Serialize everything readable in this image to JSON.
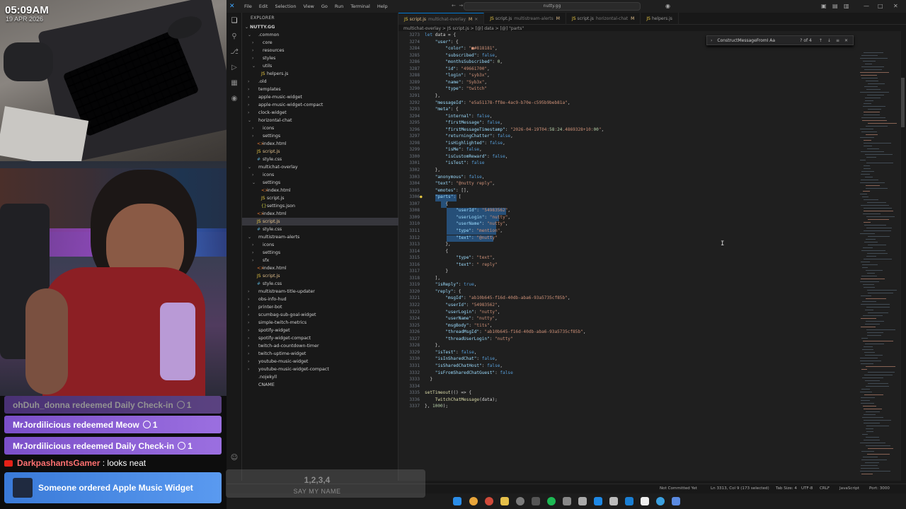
{
  "overlay": {
    "time": "05:09AM",
    "date": "19 APR 2026",
    "alerts": [
      {
        "user": "ohDuh_donna",
        "text": "redeemed Daily Check-in",
        "cost": "1"
      },
      {
        "user": "MrJordilicious",
        "text": "redeemed Meow",
        "cost": "1"
      },
      {
        "user": "MrJordilicious",
        "text": "redeemed Daily Check-in",
        "cost": "1"
      }
    ],
    "chat": {
      "user": "DarkpashantsGamer",
      "message": ": looks neat"
    },
    "order": "Someone ordered Apple Music Widget",
    "ghost": {
      "numbers": "1,2,3,4",
      "text": "SAY MY NAME"
    }
  },
  "titlebar": {
    "menus": [
      "File",
      "Edit",
      "Selection",
      "View",
      "Go",
      "Run",
      "Terminal",
      "Help"
    ],
    "search": "nutty.gg"
  },
  "explorer": {
    "title": "EXPLORER",
    "root": "NUTTY.GG",
    "items": [
      {
        "label": ".common",
        "type": "folder",
        "open": true
      },
      {
        "label": "core",
        "type": "folder"
      },
      {
        "label": "resources",
        "type": "folder"
      },
      {
        "label": "styles",
        "type": "folder"
      },
      {
        "label": "utils",
        "type": "folder",
        "open": true
      },
      {
        "label": "helpers.js",
        "type": "js"
      },
      {
        "label": ".old",
        "type": "folder"
      },
      {
        "label": "templates",
        "type": "folder"
      },
      {
        "label": "apple-music-widget",
        "type": "folder"
      },
      {
        "label": "apple-music-widget-compact",
        "type": "folder"
      },
      {
        "label": "clock-widget",
        "type": "folder"
      },
      {
        "label": "horizontal-chat",
        "type": "folder",
        "open": true
      },
      {
        "label": "icons",
        "type": "folder"
      },
      {
        "label": "settings",
        "type": "folder"
      },
      {
        "label": "index.html",
        "type": "html"
      },
      {
        "label": "script.js",
        "type": "js",
        "mod": "M"
      },
      {
        "label": "style.css",
        "type": "css"
      },
      {
        "label": "multichat-overlay",
        "type": "folder",
        "open": true
      },
      {
        "label": "icons",
        "type": "folder"
      },
      {
        "label": "settings",
        "type": "folder",
        "open": true
      },
      {
        "label": "index.html",
        "type": "html"
      },
      {
        "label": "script.js",
        "type": "js"
      },
      {
        "label": "settings.json",
        "type": "json"
      },
      {
        "label": "index.html",
        "type": "html"
      },
      {
        "label": "script.js",
        "type": "js",
        "mod": "M"
      },
      {
        "label": "style.css",
        "type": "css"
      },
      {
        "label": "multistream-alerts",
        "type": "folder",
        "open": true
      },
      {
        "label": "icons",
        "type": "folder"
      },
      {
        "label": "settings",
        "type": "folder"
      },
      {
        "label": "sfx",
        "type": "folder"
      },
      {
        "label": "index.html",
        "type": "html"
      },
      {
        "label": "script.js",
        "type": "js",
        "mod": "M"
      },
      {
        "label": "style.css",
        "type": "css"
      },
      {
        "label": "multistream-title-updater",
        "type": "folder"
      },
      {
        "label": "obs-info-hud",
        "type": "folder"
      },
      {
        "label": "printer-bot",
        "type": "folder"
      },
      {
        "label": "scumbag-sub-goal-widget",
        "type": "folder"
      },
      {
        "label": "simple-twitch-metrics",
        "type": "folder"
      },
      {
        "label": "spotify-widget",
        "type": "folder"
      },
      {
        "label": "spotify-widget-compact",
        "type": "folder"
      },
      {
        "label": "twitch-ad-countdown-timer",
        "type": "folder"
      },
      {
        "label": "twitch-uptime-widget",
        "type": "folder"
      },
      {
        "label": "youtube-music-widget",
        "type": "folder"
      },
      {
        "label": "youtube-music-widget-compact",
        "type": "folder"
      },
      {
        "label": ".nojekyll",
        "type": "file"
      },
      {
        "label": "CNAME",
        "type": "file"
      }
    ]
  },
  "tabs": [
    {
      "label": "script.js",
      "path": "multichat-overlay",
      "mod": "M",
      "active": true
    },
    {
      "label": "script.js",
      "path": "multistream-alerts",
      "mod": "M"
    },
    {
      "label": "script.js",
      "path": "horizontal-chat",
      "mod": "M"
    },
    {
      "label": "helpers.js",
      "path": "",
      "mod": ""
    }
  ],
  "breadcrumb": "multichat-overlay > JS script.js > [@] data > [@] \"parts\"",
  "find": {
    "value": "ConstructMessageFromI Aa",
    "count": "? of 4"
  },
  "code": [
    {
      "n": "3273",
      "t": "let data = {"
    },
    {
      "n": "3274",
      "t": "    \"user\": {"
    },
    {
      "n": "3284",
      "t": "        \"color\": \"■#818181\","
    },
    {
      "n": "3285",
      "t": "        \"subscribed\": false,"
    },
    {
      "n": "3286",
      "t": "        \"monthsSubscribed\": 0,"
    },
    {
      "n": "3287",
      "t": "        \"id\": \"49661700\","
    },
    {
      "n": "3288",
      "t": "        \"login\": \"syb3x\","
    },
    {
      "n": "3289",
      "t": "        \"name\": \"Syb3x\","
    },
    {
      "n": "3290",
      "t": "        \"type\": \"twitch\""
    },
    {
      "n": "3291",
      "t": "    },"
    },
    {
      "n": "3292",
      "t": "    \"messageId\": \"e5a51178-ff8e-4ac9-b70e-c595b9beb81a\","
    },
    {
      "n": "3293",
      "t": "    \"meta\": {"
    },
    {
      "n": "3294",
      "t": "        \"internal\": false,"
    },
    {
      "n": "3295",
      "t": "        \"firstMessage\": false,"
    },
    {
      "n": "3296",
      "t": "        \"firstMessageTimestamp\": \"2026-04-19T04:58:24.4869328+10:00\","
    },
    {
      "n": "3297",
      "t": "        \"returningChatter\": false,"
    },
    {
      "n": "3298",
      "t": "        \"isHighlighted\": false,"
    },
    {
      "n": "3299",
      "t": "        \"isMe\": false,"
    },
    {
      "n": "3300",
      "t": "        \"isCustomReward\": false,"
    },
    {
      "n": "3301",
      "t": "        \"isTest\": false"
    },
    {
      "n": "3302",
      "t": "    },"
    },
    {
      "n": "3303",
      "t": "    \"anonymous\": false,"
    },
    {
      "n": "3304",
      "t": "    \"text\": \"@nutty reply\","
    },
    {
      "n": "3305",
      "t": "    \"emotes\": [],"
    },
    {
      "n": "3306",
      "t": "    \"parts\": ["
    },
    {
      "n": "3307",
      "t": "        {"
    },
    {
      "n": "3308",
      "t": "            \"userId\": \"54983562\","
    },
    {
      "n": "3309",
      "t": "            \"userLogin\": \"nutty\","
    },
    {
      "n": "3310",
      "t": "            \"userName\": \"nutty\","
    },
    {
      "n": "3311",
      "t": "            \"type\": \"mention\","
    },
    {
      "n": "3312",
      "t": "            \"text\": \"@nutty\""
    },
    {
      "n": "3313",
      "t": "        },"
    },
    {
      "n": "3314",
      "t": "        {"
    },
    {
      "n": "3315",
      "t": "            \"type\": \"text\","
    },
    {
      "n": "3316",
      "t": "            \"text\": \" reply\""
    },
    {
      "n": "3317",
      "t": "        }"
    },
    {
      "n": "3318",
      "t": "    ],"
    },
    {
      "n": "3319",
      "t": "    \"isReply\": true,"
    },
    {
      "n": "3320",
      "t": "    \"reply\": {"
    },
    {
      "n": "3321",
      "t": "        \"msgId\": \"ab10b645-f16d-40db-aba6-93a5735cf85b\","
    },
    {
      "n": "3322",
      "t": "        \"userId\": \"54983562\","
    },
    {
      "n": "3323",
      "t": "        \"userLogin\": \"nutty\","
    },
    {
      "n": "3324",
      "t": "        \"userName\": \"nutty\","
    },
    {
      "n": "3325",
      "t": "        \"msgBody\": \"tits\","
    },
    {
      "n": "3326",
      "t": "        \"threadMsgId\": \"ab10b645-f16d-40db-aba6-93a5735cf85b\","
    },
    {
      "n": "3327",
      "t": "        \"threadUserLogin\": \"nutty\""
    },
    {
      "n": "3328",
      "t": "    },"
    },
    {
      "n": "3329",
      "t": "    \"isTest\": false,"
    },
    {
      "n": "3330",
      "t": "    \"isInSharedChat\": false,"
    },
    {
      "n": "3331",
      "t": "    \"isSharedChatHost\": false,"
    },
    {
      "n": "3332",
      "t": "    \"isFromSharedChatGuest\": false"
    },
    {
      "n": "3333",
      "t": "  }"
    },
    {
      "n": "3334",
      "t": ""
    },
    {
      "n": "3335",
      "t": "setTimeout(() => {"
    },
    {
      "n": "3336",
      "t": "    TwitchChatMessage(data);"
    },
    {
      "n": "3337",
      "t": "}, 1000);"
    }
  ],
  "status": {
    "git": "Not Committed Yet",
    "position": "Ln 3313, Col 9 (173 selected)",
    "tab": "Tab Size: 4",
    "encoding": "UTF-8",
    "eol": "CRLF",
    "lang": "JavaScript",
    "port": "Port: 3000"
  },
  "colors": {
    "accent": "#0078d4",
    "alert": "#9b6fe0",
    "order": "#4a8ae4",
    "modified": "#e2c08d"
  }
}
